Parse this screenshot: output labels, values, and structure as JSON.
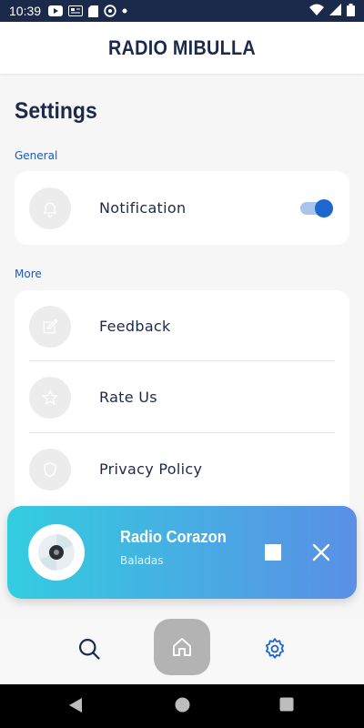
{
  "status_bar": {
    "time": "10:39"
  },
  "header": {
    "title": "RADIO MIBULLA"
  },
  "page": {
    "title": "Settings"
  },
  "general": {
    "label": "General",
    "notification": {
      "label": "Notification",
      "enabled": true
    }
  },
  "more": {
    "label": "More",
    "items": [
      {
        "label": "Feedback",
        "icon": "feedback-icon"
      },
      {
        "label": "Rate Us",
        "icon": "star-icon"
      },
      {
        "label": "Privacy Policy",
        "icon": "shield-icon"
      }
    ]
  },
  "player": {
    "station": "Radio Corazon",
    "genre": "Baladas"
  },
  "colors": {
    "brand_dark": "#1b2a4a",
    "accent": "#1e66d0",
    "player_gradient_start": "#33cde0",
    "player_gradient_end": "#5a8fe6"
  },
  "bottom_nav": {
    "items": [
      "search-icon",
      "home-icon",
      "settings-gear-icon"
    ],
    "active": "settings-gear-icon"
  }
}
